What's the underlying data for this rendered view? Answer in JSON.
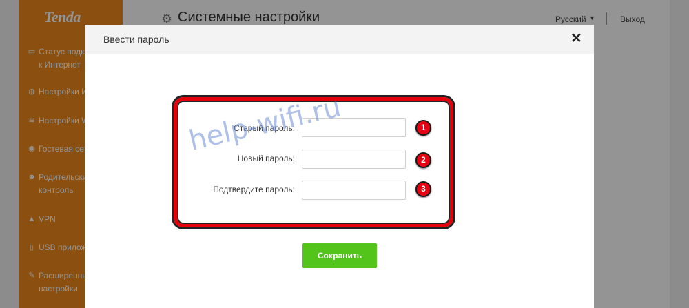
{
  "sidebar": {
    "logo": "Tenda",
    "items": [
      {
        "label": "Статус подключения к Интернет",
        "icon": "status-icon"
      },
      {
        "label": "Настройки Интернет",
        "icon": "globe-icon"
      },
      {
        "label": "Настройки WiFi",
        "icon": "wifi-icon"
      },
      {
        "label": "Гостевая сеть",
        "icon": "guest-icon"
      },
      {
        "label": "Родительский контроль",
        "icon": "parental-icon"
      },
      {
        "label": "VPN",
        "icon": "vpn-icon"
      },
      {
        "label": "USB приложения",
        "icon": "usb-icon"
      },
      {
        "label": "Расширенные настройки",
        "icon": "wrench-icon"
      }
    ]
  },
  "header": {
    "title": "Системные настройки",
    "language": "Русский",
    "logout": "Выход"
  },
  "modal": {
    "title": "Ввести пароль",
    "fields": [
      {
        "label": "Старый пароль:",
        "value": "",
        "badge": "1"
      },
      {
        "label": "Новый пароль:",
        "value": "",
        "badge": "2"
      },
      {
        "label": "Подтвердите пароль:",
        "value": "",
        "badge": "3"
      }
    ],
    "save_label": "Сохранить",
    "close_glyph": "✕"
  },
  "watermark": "help-wifi.ru",
  "colors": {
    "brand_orange": "#f08a1c",
    "save_green": "#52c41a",
    "highlight_red": "#e3000b"
  }
}
